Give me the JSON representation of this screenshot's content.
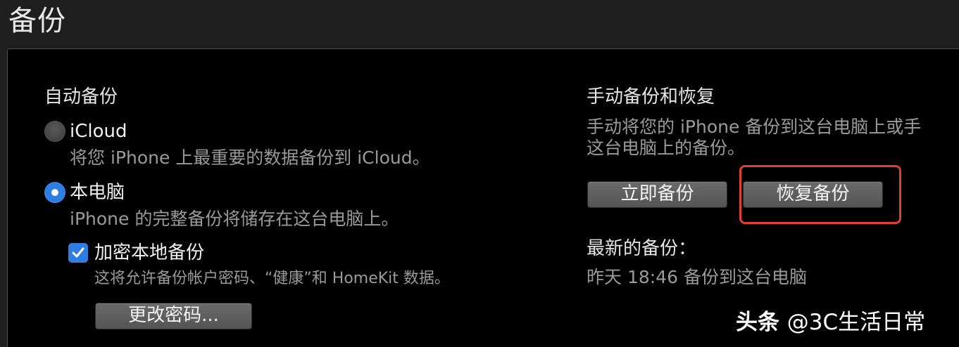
{
  "page": {
    "title": "备份"
  },
  "auto_backup": {
    "heading": "自动备份",
    "icloud": {
      "label": "iCloud",
      "description": "将您 iPhone 上最重要的数据备份到 iCloud。",
      "selected": false
    },
    "this_computer": {
      "label": "本电脑",
      "description": "iPhone 的完整备份将储存在这台电脑上。",
      "selected": true
    },
    "encrypt": {
      "label": "加密本地备份",
      "description": "这将允许备份帐户密码、“健康”和 HomeKit 数据。",
      "checked": true
    },
    "change_password_label": "更改密码..."
  },
  "manual_backup": {
    "heading": "手动备份和恢复",
    "description_line1": "手动将您的 iPhone 备份到这台电脑上或手",
    "description_line2": "这台电脑上的备份。",
    "backup_now_label": "立即备份",
    "restore_label": "恢复备份",
    "latest_heading": "最新的备份：",
    "latest_value": "昨天 18:46 备份到这台电脑"
  },
  "watermark": {
    "source": "头条",
    "handle": "@3C生活日常"
  },
  "colors": {
    "accent": "#2f7de1",
    "highlight": "#e0412f",
    "panel_bg": "#000000",
    "page_bg": "#1e1e1e"
  }
}
